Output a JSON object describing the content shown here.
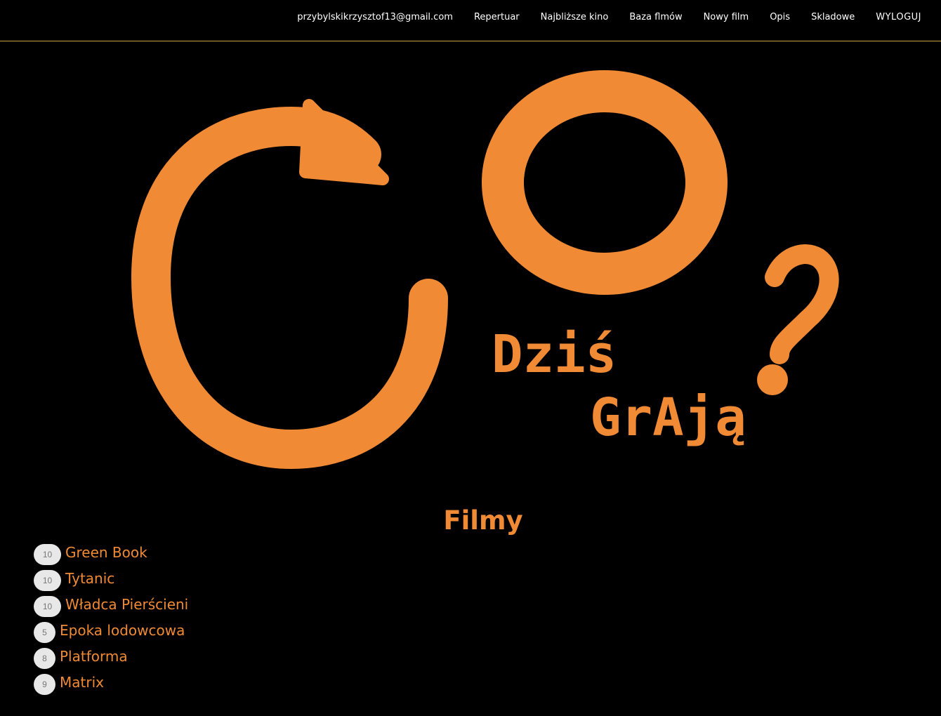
{
  "header": {
    "email": "przybylskikrzysztof13@gmail.com",
    "nav": [
      "Repertuar",
      "Najbliższe kino",
      "Baza flmów",
      "Nowy film",
      "Opis",
      "Skladowe"
    ],
    "logout": "WYLOGUJ"
  },
  "logo": {
    "line1": "Dziś",
    "line2": "GrAją",
    "question": "?"
  },
  "section_title": "Filmy",
  "films": [
    {
      "rating": "10",
      "title": "Green Book"
    },
    {
      "rating": "10",
      "title": "Tytanic"
    },
    {
      "rating": "10",
      "title": "Władca Pierścieni"
    },
    {
      "rating": "5",
      "title": "Epoka lodowcowa"
    },
    {
      "rating": "8",
      "title": "Platforma"
    },
    {
      "rating": "9",
      "title": "Matrix"
    }
  ],
  "colors": {
    "accent": "#f08a34",
    "background": "#000000",
    "divider": "#c9a23a"
  }
}
